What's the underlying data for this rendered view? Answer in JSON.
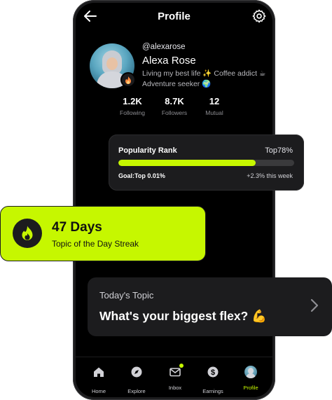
{
  "header": {
    "title": "Profile"
  },
  "profile": {
    "username": "@alexarose",
    "name": "Alexa Rose",
    "bio": "Living my best life ✨ Coffee addict ☕ Adventure seeker 🌍"
  },
  "stats": [
    {
      "value": "1.2K",
      "label": "Following"
    },
    {
      "value": "8.7K",
      "label": "Followers"
    },
    {
      "value": "12",
      "label": "Mutual"
    }
  ],
  "popularity": {
    "title": "Popularity Rank",
    "rank": "Top78%",
    "progress": 0.78,
    "goal": "Goal:Top 0.01%",
    "change": "+2.3% this week"
  },
  "streak": {
    "days": "47 Days",
    "label": "Topic of the Day Streak"
  },
  "topic": {
    "kicker": "Today's Topic",
    "question": "What's your biggest flex? 💪"
  },
  "nav": [
    {
      "label": "Home",
      "icon": "home-icon"
    },
    {
      "label": "Explore",
      "icon": "compass-icon"
    },
    {
      "label": "Inbox",
      "icon": "inbox-icon"
    },
    {
      "label": "Earnings",
      "icon": "dollar-icon"
    },
    {
      "label": "Profile",
      "icon": "avatar-icon"
    }
  ],
  "colors": {
    "accent": "#c6f700",
    "card": "#1c1c1e",
    "background": "#000000"
  }
}
